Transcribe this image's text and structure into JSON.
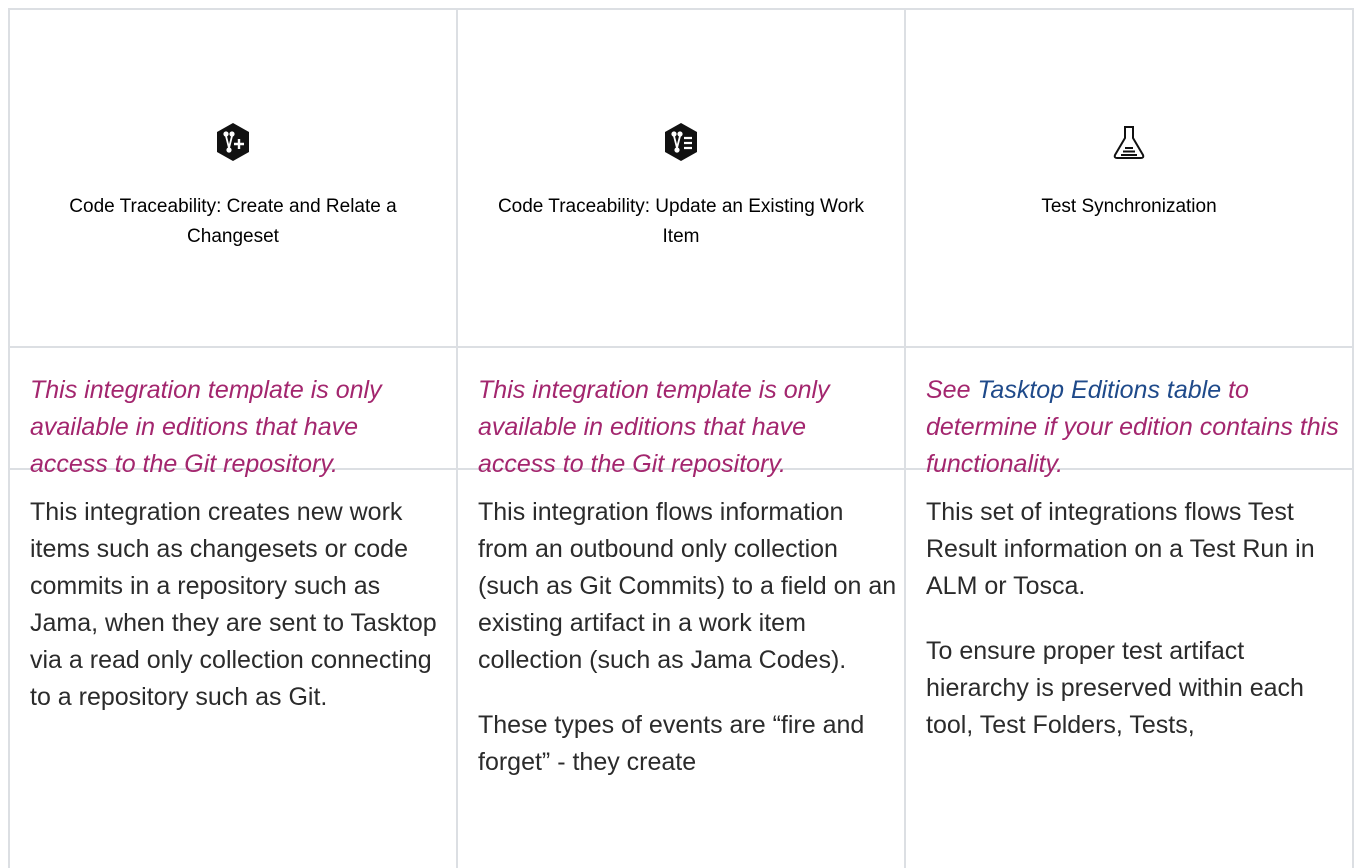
{
  "columns": [
    {
      "icon": "git-branch-plus-icon",
      "title": "Code Traceability: Create and Relate a Changeset",
      "note": "This integration template is only available in editions that have access to the Git repository.",
      "paragraphs": [
        "This integration creates new work items such as changesets or code commits in a repository such as Jama, when they are sent to Tasktop via a read only collection connecting to a repository such as Git."
      ]
    },
    {
      "icon": "git-branch-list-icon",
      "title": "Code Traceability: Update an Existing Work Item",
      "note": "This integration template is only available in editions that have access to the Git repository.",
      "paragraphs": [
        "This integration flows information from an outbound only collection (such as Git Commits) to a field on an existing artifact in a work item collection (such as Jama Codes).",
        "These types of events are “fire and forget” - they create"
      ]
    },
    {
      "icon": "flask-icon",
      "title": "Test Synchronization",
      "note_prefix": "See ",
      "note_link": "Tasktop Editions table",
      "note_suffix": " to determine if your edition contains this functionality.",
      "paragraphs": [
        "This set of integrations flows Test Result information on a Test Run in ALM or Tosca.",
        "To ensure proper test artifact hierarchy is preserved within each tool, Test Folders, Tests,"
      ]
    }
  ],
  "colors": {
    "note": "#a3266e",
    "link": "#1f4a8a",
    "border": "#dcdfe3"
  }
}
